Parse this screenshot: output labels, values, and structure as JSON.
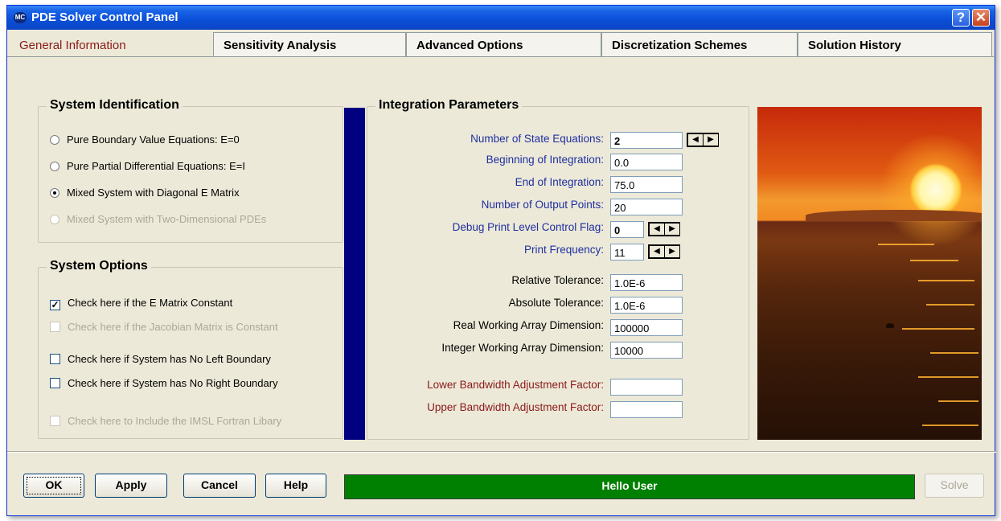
{
  "window": {
    "title": "PDE Solver Control Panel",
    "icon_text": "MC",
    "help_glyph": "?",
    "close_glyph": "✕"
  },
  "tabs": [
    {
      "label": "General Information",
      "active": true
    },
    {
      "label": "Sensitivity Analysis"
    },
    {
      "label": "Advanced Options"
    },
    {
      "label": "Discretization Schemes"
    },
    {
      "label": "Solution History"
    }
  ],
  "system_identification": {
    "title": "System Identification",
    "options": [
      {
        "label": "Pure Boundary Value Equations: E=0",
        "selected": false
      },
      {
        "label": "Pure Partial Differential Equations: E=I",
        "selected": false
      },
      {
        "label": "Mixed System with Diagonal E Matrix",
        "selected": true
      },
      {
        "label": "Mixed System with Two-Dimensional PDEs",
        "selected": false,
        "disabled": true
      }
    ]
  },
  "system_options": {
    "title": "System Options",
    "options": [
      {
        "label": "Check here if the E Matrix Constant",
        "checked": true
      },
      {
        "label": "Check here if the Jacobian Matrix is Constant",
        "checked": false,
        "disabled": true
      },
      {
        "label": "Check here if System has No Left Boundary",
        "checked": false
      },
      {
        "label": "Check here if System has No Right Boundary",
        "checked": false
      },
      {
        "label": "Check here to Include the IMSL Fortran Libary",
        "checked": false,
        "disabled": true
      }
    ]
  },
  "integration": {
    "title": "Integration Parameters",
    "params": [
      {
        "label": "Number of State Equations:",
        "value": "2"
      },
      {
        "label": "Beginning of Integration:",
        "value": "0.0"
      },
      {
        "label": "End of Integration:",
        "value": "75.0"
      },
      {
        "label": "Number of Output Points:",
        "value": "20"
      },
      {
        "label": "Debug Print Level Control Flag:",
        "value": "0"
      },
      {
        "label": "Print Frequency:",
        "value": "11"
      },
      {
        "label": "Relative Tolerance:",
        "value": "1.0E-6"
      },
      {
        "label": "Absolute Tolerance:",
        "value": "1.0E-6"
      },
      {
        "label": "Real Working Array Dimension:",
        "value": "100000"
      },
      {
        "label": "Integer Working Array Dimension:",
        "value": "10000"
      },
      {
        "label": "Lower Bandwidth Adjustment Factor:",
        "value": ""
      },
      {
        "label": "Upper Bandwidth Adjustment Factor:",
        "value": ""
      }
    ],
    "spin_left": "◀",
    "spin_right": "▶"
  },
  "buttons": {
    "ok": "OK",
    "apply": "Apply",
    "cancel": "Cancel",
    "help": "Help",
    "solve": "Solve"
  },
  "status": {
    "text": "Hello User",
    "color": "#008000"
  },
  "colors": {
    "titlebar": "#0a4fd8",
    "label_blue": "#1f2fa0",
    "label_red": "#8b1a1a",
    "accent_bar": "#000080"
  }
}
